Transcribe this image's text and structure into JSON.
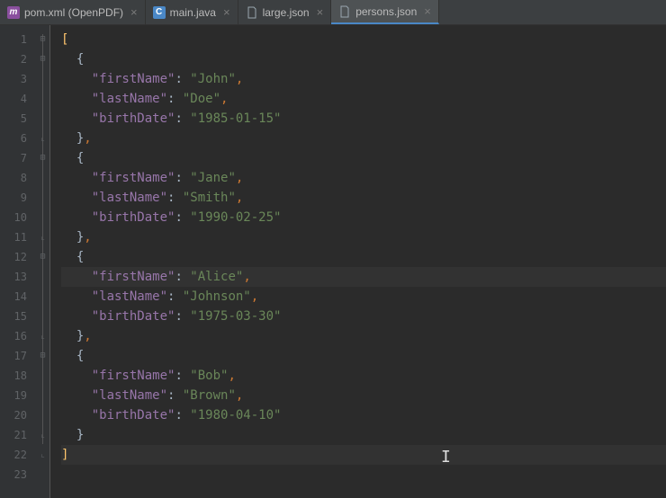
{
  "tabs": [
    {
      "label": "pom.xml (OpenPDF)",
      "icon": "m",
      "active": false
    },
    {
      "label": "main.java",
      "icon": "c",
      "active": false
    },
    {
      "label": "large.json",
      "icon": "json",
      "active": false
    },
    {
      "label": "persons.json",
      "icon": "json",
      "active": true
    }
  ],
  "gutter": [
    "1",
    "2",
    "3",
    "4",
    "5",
    "6",
    "7",
    "8",
    "9",
    "10",
    "11",
    "12",
    "13",
    "14",
    "15",
    "16",
    "17",
    "18",
    "19",
    "20",
    "21",
    "22",
    "23"
  ],
  "code": {
    "l1": "[",
    "l2_open": "{",
    "l3_k": "\"firstName\"",
    "l3_c": ": ",
    "l3_v": "\"John\"",
    "l3_e": ",",
    "l4_k": "\"lastName\"",
    "l4_c": ": ",
    "l4_v": "\"Doe\"",
    "l4_e": ",",
    "l5_k": "\"birthDate\"",
    "l5_c": ": ",
    "l5_v": "\"1985-01-15\"",
    "l6_close": "}",
    "l6_e": ",",
    "l7_open": "{",
    "l8_k": "\"firstName\"",
    "l8_c": ": ",
    "l8_v": "\"Jane\"",
    "l8_e": ",",
    "l9_k": "\"lastName\"",
    "l9_c": ": ",
    "l9_v": "\"Smith\"",
    "l9_e": ",",
    "l10_k": "\"birthDate\"",
    "l10_c": ": ",
    "l10_v": "\"1990-02-25\"",
    "l11_close": "}",
    "l11_e": ",",
    "l12_open": "{",
    "l13_k": "\"firstName\"",
    "l13_c": ": ",
    "l13_v": "\"Alice\"",
    "l13_e": ",",
    "l14_k": "\"lastName\"",
    "l14_c": ": ",
    "l14_v": "\"Johnson\"",
    "l14_e": ",",
    "l15_k": "\"birthDate\"",
    "l15_c": ": ",
    "l15_v": "\"1975-03-30\"",
    "l16_close": "}",
    "l16_e": ",",
    "l17_open": "{",
    "l18_k": "\"firstName\"",
    "l18_c": ": ",
    "l18_v": "\"Bob\"",
    "l18_e": ",",
    "l19_k": "\"lastName\"",
    "l19_c": ": ",
    "l19_v": "\"Brown\"",
    "l19_e": ",",
    "l20_k": "\"birthDate\"",
    "l20_c": ": ",
    "l20_v": "\"1980-04-10\"",
    "l21_close": "}",
    "l22": "]"
  }
}
